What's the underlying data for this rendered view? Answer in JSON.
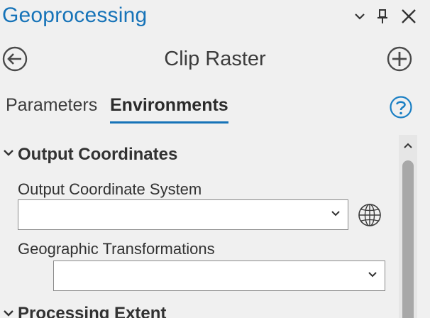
{
  "pane": {
    "title": "Geoprocessing",
    "controls": {
      "options_icon": "chevron-down-icon",
      "pin_icon": "pin-icon",
      "close_icon": "close-icon"
    }
  },
  "tool": {
    "title": "Clip Raster",
    "back_icon": "back-arrow-icon",
    "add_icon": "add-icon"
  },
  "tabs": [
    {
      "label": "Parameters",
      "active": false
    },
    {
      "label": "Environments",
      "active": true
    }
  ],
  "help_icon": "help-icon",
  "sections": [
    {
      "title": "Output Coordinates",
      "expanded": true,
      "fields": [
        {
          "label": "Output Coordinate System",
          "value": "",
          "has_globe": true
        },
        {
          "label": "Geographic Transformations",
          "value": ""
        }
      ]
    },
    {
      "title": "Processing Extent",
      "expanded": true
    }
  ],
  "colors": {
    "accent": "#1673b8",
    "background": "#f0f0f0",
    "text": "#323232",
    "field_border": "#8a8a8a"
  }
}
